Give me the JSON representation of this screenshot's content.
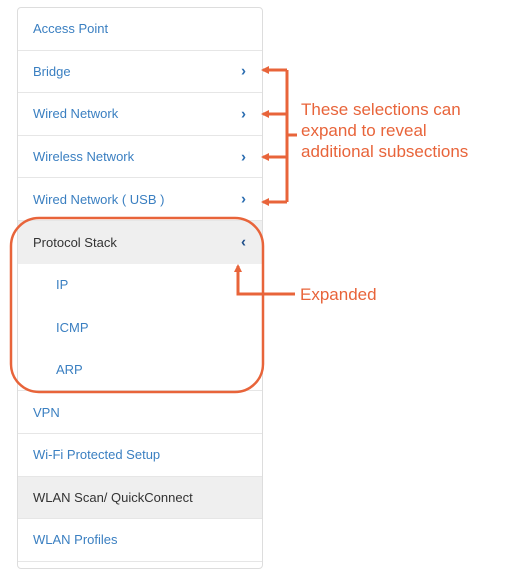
{
  "menu": {
    "items": [
      {
        "label": "Access Point"
      },
      {
        "label": "Bridge"
      },
      {
        "label": "Wired Network"
      },
      {
        "label": "Wireless Network"
      },
      {
        "label": "Wired Network ( USB )"
      },
      {
        "label": "Protocol Stack"
      },
      {
        "label": "IP"
      },
      {
        "label": "ICMP"
      },
      {
        "label": "ARP"
      },
      {
        "label": "VPN"
      },
      {
        "label": "Wi-Fi Protected Setup"
      },
      {
        "label": "WLAN Scan/ QuickConnect"
      },
      {
        "label": "WLAN Profiles"
      }
    ],
    "chevron_right": "›",
    "chevron_left": "‹"
  },
  "annotations": {
    "selections_line1": "These selections can",
    "selections_line2": "expand to reveal",
    "selections_line3": "additional subsections",
    "expanded": "Expanded"
  },
  "colors": {
    "link": "#3a7fc1",
    "annotation": "#e8643a",
    "selected_bg": "#efefef"
  }
}
